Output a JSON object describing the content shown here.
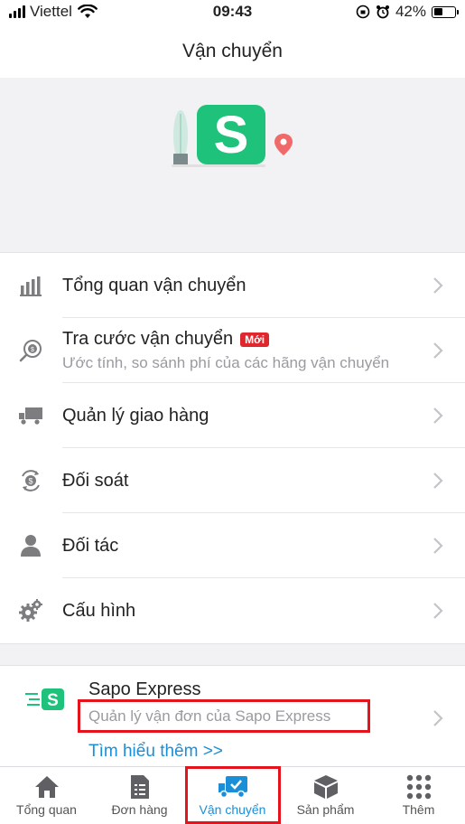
{
  "status_bar": {
    "carrier": "Viettel",
    "time": "09:43",
    "battery": "42%",
    "battery_level": 0.42
  },
  "header": {
    "title": "Vận chuyển"
  },
  "menu": [
    {
      "label": "Tổng quan vận chuyển",
      "icon": "bar-chart-icon"
    },
    {
      "label": "Tra cước vận chuyển",
      "badge": "Mới",
      "sub": "Ước tính, so sánh phí của các hãng vận chuyển",
      "icon": "search-coin-icon"
    },
    {
      "label": "Quản lý giao hàng",
      "icon": "truck-icon"
    },
    {
      "label": "Đối soát",
      "icon": "refresh-coin-icon"
    },
    {
      "label": "Đối tác",
      "icon": "person-icon"
    },
    {
      "label": "Cấu hình",
      "icon": "gear-icon"
    }
  ],
  "express": {
    "title": "Sapo Express",
    "subtitle": "Quản lý vận đơn của Sapo Express",
    "link": "Tìm hiểu thêm >>"
  },
  "tabbar": [
    {
      "label": "Tổng quan",
      "icon": "home-icon"
    },
    {
      "label": "Đơn hàng",
      "icon": "document-icon"
    },
    {
      "label": "Vận chuyển",
      "icon": "delivery-truck-icon",
      "active": true
    },
    {
      "label": "Sản phẩm",
      "icon": "box-icon"
    },
    {
      "label": "Thêm",
      "icon": "grid-dots-icon"
    }
  ],
  "colors": {
    "accent": "#1a8fd8",
    "brand_green": "#1ec27a",
    "badge_red": "#e0272e",
    "highlight_red": "#e5131b"
  }
}
